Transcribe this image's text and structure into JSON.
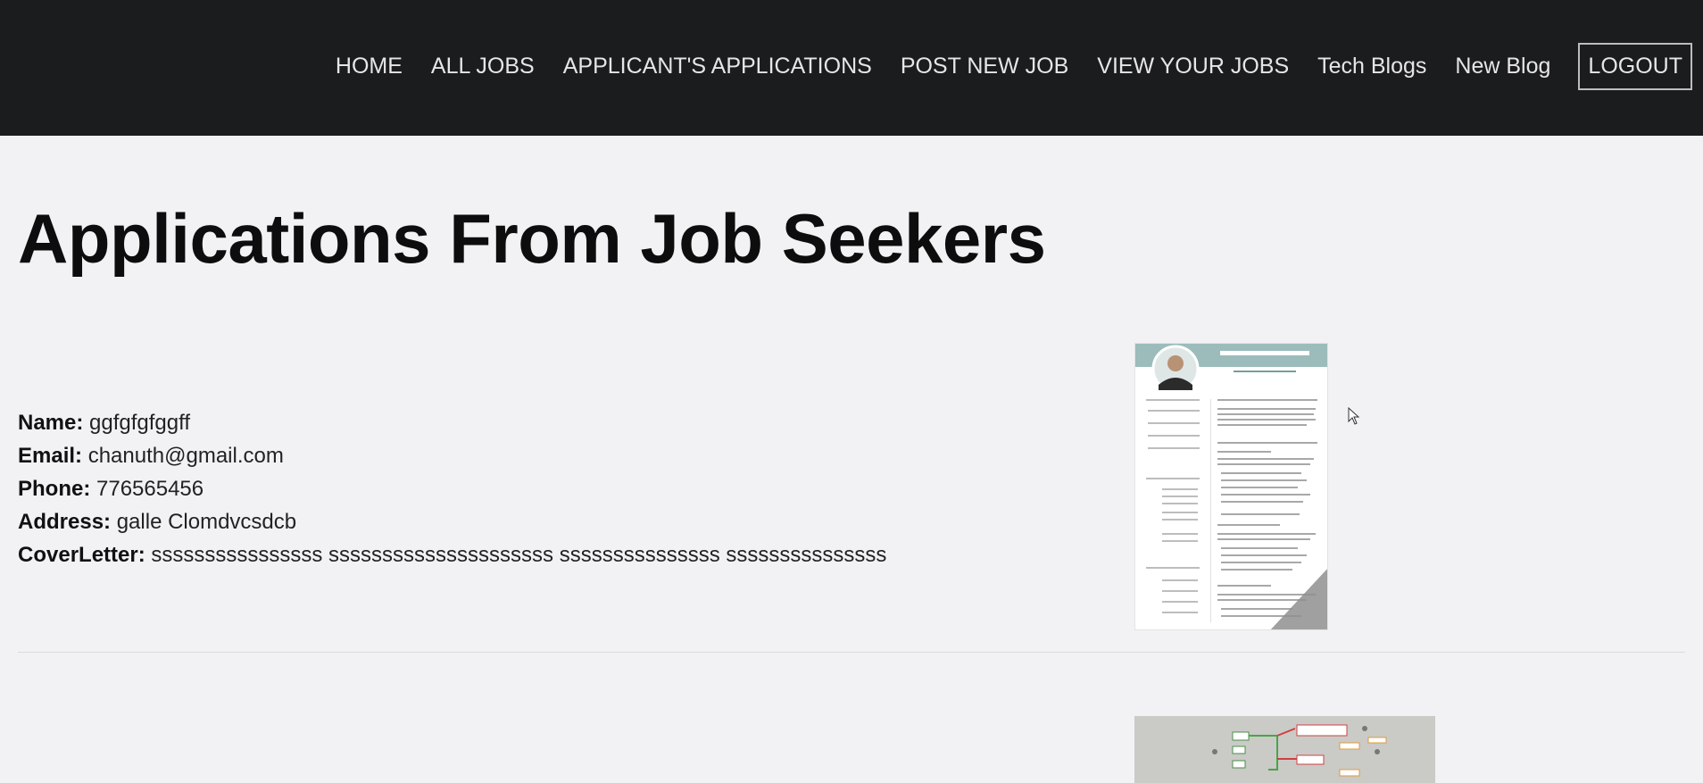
{
  "nav": {
    "items": [
      {
        "label": "HOME"
      },
      {
        "label": "ALL JOBS"
      },
      {
        "label": "APPLICANT'S APPLICATIONS"
      },
      {
        "label": "POST NEW JOB"
      },
      {
        "label": "VIEW YOUR JOBS"
      },
      {
        "label": "Tech Blogs"
      },
      {
        "label": "New Blog"
      }
    ],
    "logout_label": "LOGOUT"
  },
  "page": {
    "title": "Applications From Job Seekers"
  },
  "applications": [
    {
      "name_label": "Name:",
      "name": "ggfgfgfggff",
      "email_label": "Email:",
      "email": "chanuth@gmail.com",
      "phone_label": "Phone:",
      "phone": "776565456",
      "address_label": "Address:",
      "address": "galle Clomdvcsdcb",
      "cover_label": "CoverLetter:",
      "cover_letter": "ssssssssssssssss sssssssssssssssssssss sssssssssssssss sssssssssssssss",
      "attachment_image": "resume-thumbnail"
    },
    {
      "attachment_image": "mind-map-thumbnail"
    }
  ],
  "colors": {
    "navbar_bg": "#1b1c1e",
    "nav_text": "#e6e6e6",
    "page_bg": "#f2f2f5",
    "resume_header": "#9cbcbc"
  },
  "icons": {
    "cursor": "mouse-pointer-icon"
  }
}
